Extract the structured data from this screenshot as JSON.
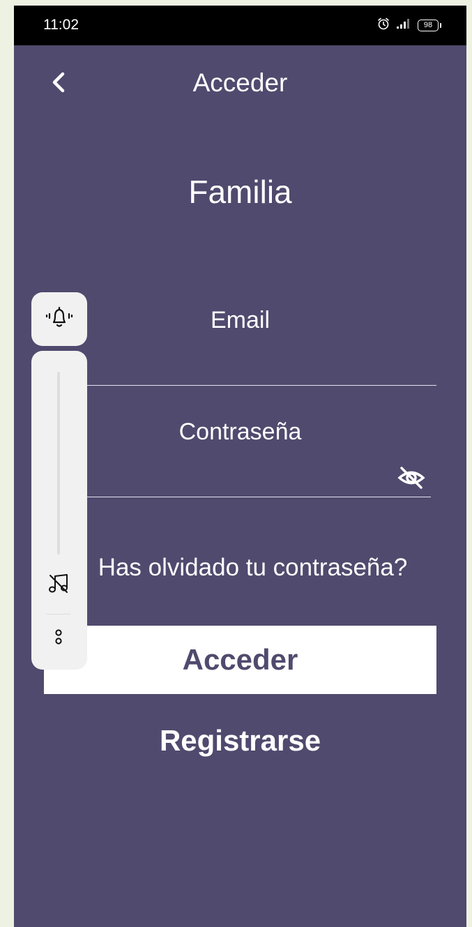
{
  "status_bar": {
    "time": "11:02",
    "battery": "98"
  },
  "top_bar": {
    "title": "Acceder"
  },
  "brand": {
    "title": "Familia"
  },
  "form": {
    "email_label": "Email",
    "email_value": "",
    "password_label": "Contraseña",
    "password_value": "",
    "forgot_password": "Has olvidado tu contraseña?",
    "login_button": "Acceder",
    "register_link": "Registrarse"
  },
  "icons": {
    "back": "chevron-left-icon",
    "alarm": "alarm-clock-icon",
    "signal": "signal-icon",
    "battery": "battery-icon",
    "password_visibility": "eye-off-icon",
    "ringer": "bell-vibrate-icon",
    "mute": "music-note-off-icon",
    "more": "more-dots-icon"
  },
  "colors": {
    "background": "#504a6e",
    "status_bar": "#000000",
    "button_bg": "#ffffff",
    "button_text": "#504a6e",
    "volume_panel": "#f1f1f1"
  }
}
